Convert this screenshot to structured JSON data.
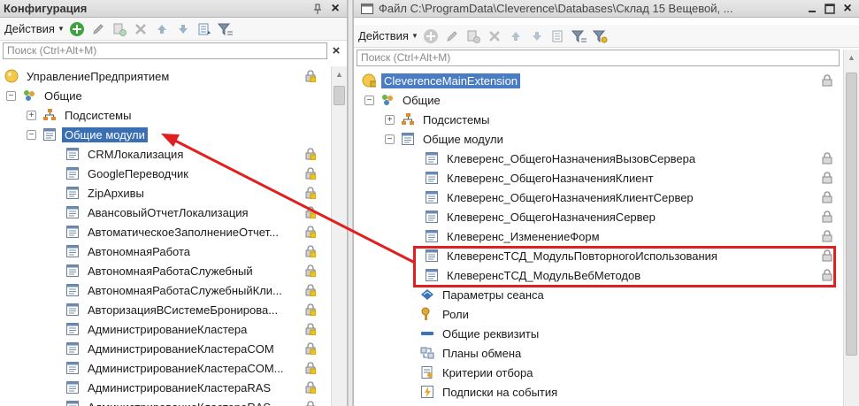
{
  "left_panel": {
    "title": "Конфигурация",
    "pin_icon": "pin-icon",
    "actions_label": "Действия",
    "search_placeholder": "Поиск (Ctrl+Alt+M)",
    "tree": [
      {
        "label": "УправлениеПредприятием",
        "icon": "config-root-icon",
        "level": 0,
        "expander": ""
      },
      {
        "label": "Общие",
        "icon": "common-icon",
        "level": 0,
        "expander": "−"
      },
      {
        "label": "Подсистемы",
        "icon": "subsystems-icon",
        "level": 1,
        "expander": "+"
      },
      {
        "label": "Общие модули",
        "icon": "module-icon",
        "level": 1,
        "expander": "−",
        "selected": true
      },
      {
        "label": "CRMЛокализация",
        "icon": "module-icon",
        "level": 2
      },
      {
        "label": "GoogleПереводчик",
        "icon": "module-icon",
        "level": 2
      },
      {
        "label": "ZipАрхивы",
        "icon": "module-icon",
        "level": 2
      },
      {
        "label": "АвансовыйОтчетЛокализация",
        "icon": "module-icon",
        "level": 2
      },
      {
        "label": "АвтоматическоеЗаполнениеОтчет...",
        "icon": "module-icon",
        "level": 2
      },
      {
        "label": "АвтономнаяРабота",
        "icon": "module-icon",
        "level": 2
      },
      {
        "label": "АвтономнаяРаботаСлужебный",
        "icon": "module-icon",
        "level": 2
      },
      {
        "label": "АвтономнаяРаботаСлужебныйКли...",
        "icon": "module-icon",
        "level": 2
      },
      {
        "label": "АвторизацияВСистемеБронирова...",
        "icon": "module-icon",
        "level": 2
      },
      {
        "label": "АдминистрированиеКластера",
        "icon": "module-icon",
        "level": 2
      },
      {
        "label": "АдминистрированиеКластераCOM",
        "icon": "module-icon",
        "level": 2
      },
      {
        "label": "АдминистрированиеКластераCOM...",
        "icon": "module-icon",
        "level": 2
      },
      {
        "label": "АдминистрированиеКластераRAS",
        "icon": "module-icon",
        "level": 2
      },
      {
        "label": "АдминистрированиеКластераRAS...",
        "icon": "module-icon",
        "level": 2
      }
    ]
  },
  "right_panel": {
    "title": "Файл C:\\ProgramData\\Cleverence\\Databases\\Склад 15 Вещевой, ...",
    "actions_label": "Действия",
    "search_placeholder": "Поиск (Ctrl+Alt+M)",
    "tree": [
      {
        "label": "CleverenceMainExtension",
        "icon": "extension-root-icon",
        "level": 0,
        "selected": true
      },
      {
        "label": "Общие",
        "icon": "common-icon",
        "level": 0,
        "expander": "−"
      },
      {
        "label": "Подсистемы",
        "icon": "subsystems-icon",
        "level": 1,
        "expander": "+"
      },
      {
        "label": "Общие модули",
        "icon": "module-icon",
        "level": 1,
        "expander": "−"
      },
      {
        "label": "Клеверенс_ОбщегоНазначенияВызовСервера",
        "icon": "module-icon",
        "level": 2
      },
      {
        "label": "Клеверенс_ОбщегоНазначенияКлиент",
        "icon": "module-icon",
        "level": 2
      },
      {
        "label": "Клеверенс_ОбщегоНазначенияКлиентСервер",
        "icon": "module-icon",
        "level": 2
      },
      {
        "label": "Клеверенс_ОбщегоНазначенияСервер",
        "icon": "module-icon",
        "level": 2
      },
      {
        "label": "Клеверенс_ИзменениеФорм",
        "icon": "module-icon",
        "level": 2
      },
      {
        "label": "КлеверенсТСД_МодульПовторногоИспользования",
        "icon": "module-icon",
        "level": 2,
        "highlighted": true
      },
      {
        "label": "КлеверенсТСД_МодульВебМетодов",
        "icon": "module-icon",
        "level": 2,
        "highlighted": true
      },
      {
        "label": "Параметры сеанса",
        "icon": "session-params-icon",
        "level": 1
      },
      {
        "label": "Роли",
        "icon": "roles-icon",
        "level": 1
      },
      {
        "label": "Общие реквизиты",
        "icon": "common-attributes-icon",
        "level": 1
      },
      {
        "label": "Планы обмена",
        "icon": "exchange-plans-icon",
        "level": 1
      },
      {
        "label": "Критерии отбора",
        "icon": "filter-criteria-icon",
        "level": 1
      },
      {
        "label": "Подписки на события",
        "icon": "event-subscriptions-icon",
        "level": 1
      }
    ]
  },
  "annotation": {
    "color": "#e02020"
  },
  "colors": {
    "selection": "#3b6fb4",
    "lock_yellow": "#f1c40f",
    "lock_gray": "#8a8a8a"
  }
}
